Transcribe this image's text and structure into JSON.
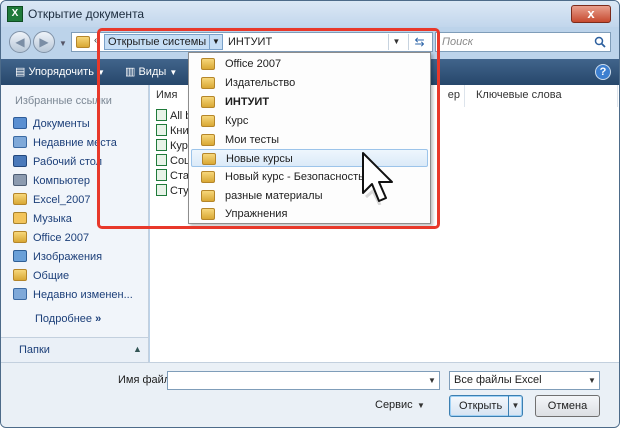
{
  "window": {
    "title": "Открытие документа",
    "app_icon": "excel-icon",
    "close_glyph": "x"
  },
  "address_bar": {
    "crumbs": [
      "Открытые системы",
      "ИНТУИТ"
    ],
    "separator": "«"
  },
  "search": {
    "placeholder": "Поиск"
  },
  "toolbar": {
    "organize": "Упорядочить",
    "views": "Виды",
    "help": "?"
  },
  "sidebar": {
    "header": "Избранные ссылки",
    "items": [
      {
        "label": "Документы",
        "icon": "documents-icon"
      },
      {
        "label": "Недавние места",
        "icon": "recent-places-icon"
      },
      {
        "label": "Рабочий стол",
        "icon": "desktop-icon"
      },
      {
        "label": "Компьютер",
        "icon": "computer-icon"
      },
      {
        "label": "Excel_2007",
        "icon": "folder-icon"
      },
      {
        "label": "Музыка",
        "icon": "music-icon"
      },
      {
        "label": "Office 2007",
        "icon": "folder-icon"
      },
      {
        "label": "Изображения",
        "icon": "pictures-icon"
      },
      {
        "label": "Общие",
        "icon": "folder-icon"
      },
      {
        "label": "Недавно изменен...",
        "icon": "recent-changed-icon"
      }
    ],
    "more": "Подробнее",
    "more_glyph": "»",
    "folders": "Папки"
  },
  "file_list": {
    "columns": [
      "Имя",
      "ер",
      "Ключевые слова"
    ],
    "rows": [
      "All b",
      "Кни",
      "Кур",
      "Соц",
      "Стат",
      "Студ"
    ]
  },
  "dropdown": {
    "items": [
      {
        "label": "Office 2007",
        "bold": false
      },
      {
        "label": "Издательство",
        "bold": false
      },
      {
        "label": "ИНТУИТ",
        "bold": true
      },
      {
        "label": "Курс",
        "bold": false
      },
      {
        "label": "Мои тесты",
        "bold": false
      },
      {
        "label": "Новые курсы",
        "bold": false,
        "hover": true
      },
      {
        "label": "Новый курс - Безопасность",
        "bold": false
      },
      {
        "label": "разные материалы",
        "bold": false
      },
      {
        "label": "Упражнения",
        "bold": false
      }
    ]
  },
  "bottom": {
    "filename_label": "Имя файла:",
    "filename_value": "",
    "filetype": "Все файлы Excel",
    "service": "Сервис",
    "open": "Открыть",
    "cancel": "Отмена"
  },
  "colors": {
    "highlight_frame": "#e8382a",
    "toolbar": "#2f5078"
  }
}
